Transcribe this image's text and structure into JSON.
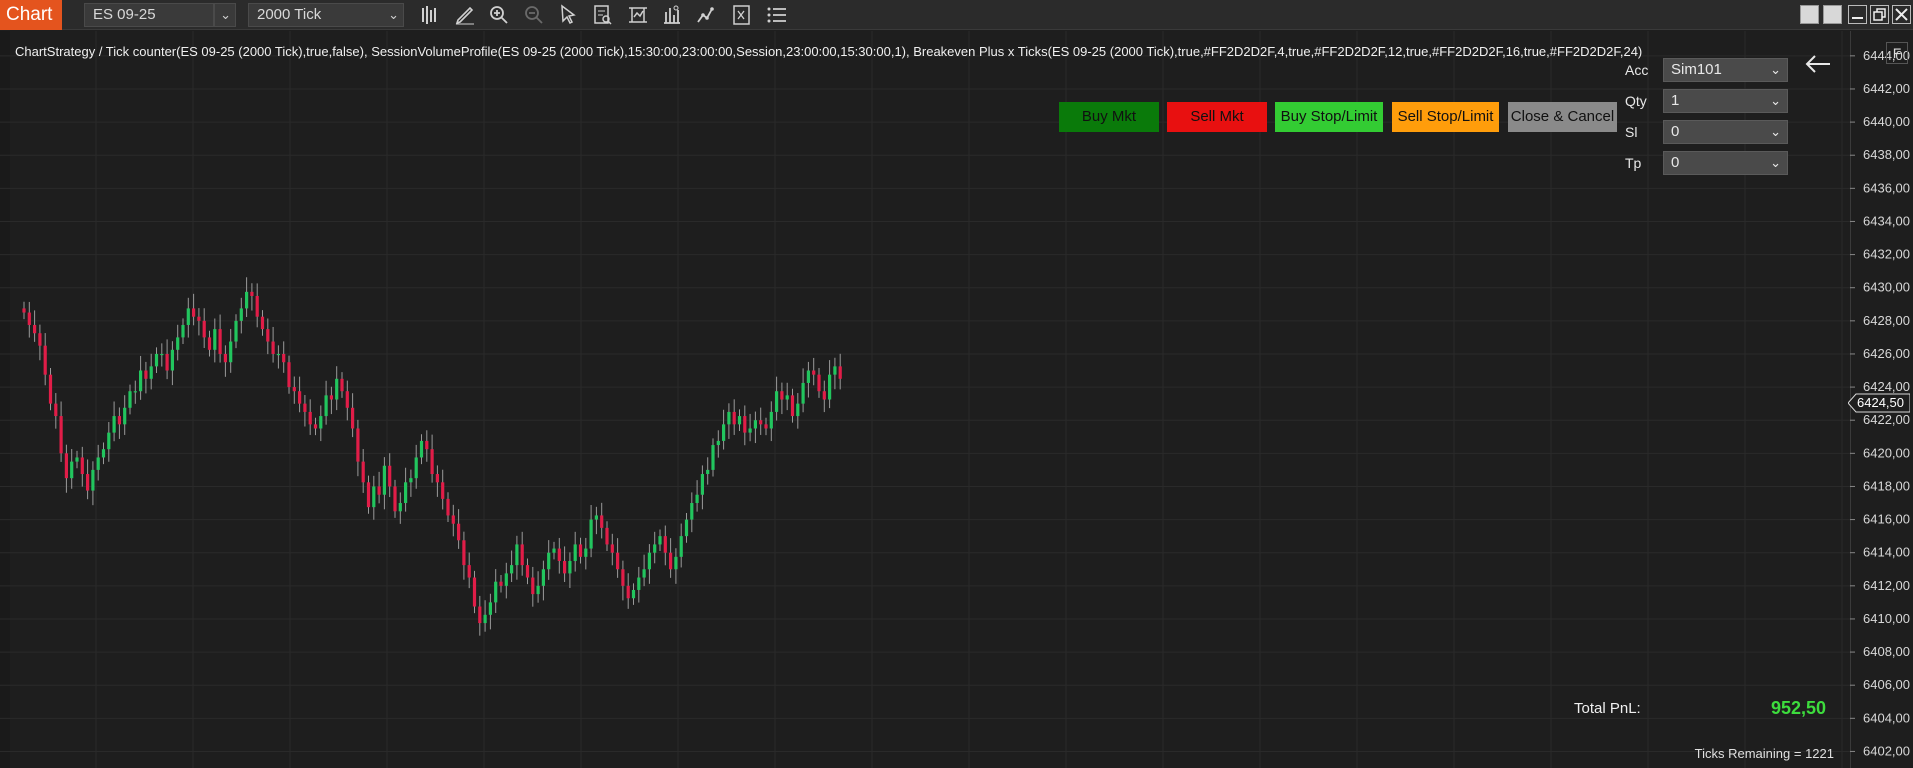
{
  "window": {
    "tab_label": "Chart",
    "instrument": "ES 09-25",
    "period": "2000 Tick",
    "tools": [
      "chart-style-icon",
      "drawing-pencil-icon",
      "zoom-in-icon",
      "zoom-out-icon",
      "pointer-icon",
      "data-box-icon",
      "indicators-icon",
      "strategies-icon",
      "chart-trader-icon",
      "properties-icon",
      "more-menu-icon"
    ]
  },
  "indicator_label": "ChartStrategy / Tick counter(ES 09-25 (2000 Tick),true,false), SessionVolumeProfile(ES 09-25 (2000 Tick),15:30:00,23:00:00,Session,23:00:00,15:30:00,1), Breakeven Plus x Ticks(ES 09-25 (2000 Tick),true,#FF2D2D2F,4,true,#FF2D2D2F,12,true,#FF2D2D2F,16,true,#FF2D2D2F,24)",
  "trade_buttons": {
    "buy_mkt": "Buy Mkt",
    "sell_mkt": "Sell Mkt",
    "buy_stop_limit": "Buy Stop/Limit",
    "sell_stop_limit": "Sell Stop/Limit",
    "close_cancel": "Close & Cancel"
  },
  "order_form": {
    "acc_label": "Acc",
    "acc_value": "Sim101",
    "qty_label": "Qty",
    "qty_value": "1",
    "sl_label": "Sl",
    "sl_value": "0",
    "tp_label": "Tp",
    "tp_value": "0"
  },
  "axis_button": "F",
  "current_price": "6424,50",
  "price_ticks": [
    "6444,00",
    "6442,00",
    "6440,00",
    "6438,00",
    "6436,00",
    "6434,00",
    "6432,00",
    "6430,00",
    "6428,00",
    "6426,00",
    "6424,00",
    "6422,00",
    "6420,00",
    "6418,00",
    "6416,00",
    "6414,00",
    "6412,00",
    "6410,00",
    "6408,00",
    "6406,00",
    "6404,00",
    "6402,00"
  ],
  "footer": {
    "pnl_label": "Total PnL:",
    "pnl_value": "952,50",
    "ticks_remaining": "Ticks Remaining = 1221"
  },
  "colors": {
    "chart_tab": "#e4541e",
    "up_candle": "#22c55e",
    "down_candle": "#e11d48",
    "pnl_positive": "#3ddc3d"
  },
  "chart_data": {
    "type": "candlestick",
    "ylim": [
      6401,
      6445.5
    ],
    "closes": [
      6428.5,
      6427.75,
      6427.25,
      6426.5,
      6424.75,
      6423.0,
      6422.25,
      6420.0,
      6418.5,
      6419.5,
      6419.75,
      6418.75,
      6417.75,
      6419.0,
      6419.75,
      6420.25,
      6421.25,
      6422.25,
      6421.75,
      6422.75,
      6423.75,
      6423.75,
      6425.0,
      6424.5,
      6425.25,
      6426.0,
      6426.0,
      6425.0,
      6426.25,
      6427.0,
      6427.75,
      6428.75,
      6428.25,
      6428.0,
      6427.0,
      6426.25,
      6427.5,
      6426.0,
      6425.5,
      6426.75,
      6428.0,
      6428.75,
      6429.75,
      6429.5,
      6428.25,
      6427.5,
      6426.75,
      6426.0,
      6426.0,
      6425.5,
      6424.0,
      6423.75,
      6423.0,
      6422.5,
      6421.75,
      6421.5,
      6422.25,
      6423.5,
      6423.25,
      6424.5,
      6423.75,
      6422.75,
      6421.5,
      6419.5,
      6418.25,
      6416.75,
      6418.0,
      6417.5,
      6419.25,
      6418.0,
      6416.5,
      6417.0,
      6418.25,
      6418.5,
      6419.75,
      6420.75,
      6420.25,
      6418.75,
      6418.25,
      6417.25,
      6416.25,
      6415.75,
      6414.75,
      6413.25,
      6412.5,
      6410.75,
      6409.75,
      6410.25,
      6411.0,
      6412.25,
      6412.0,
      6412.75,
      6413.25,
      6414.5,
      6413.25,
      6412.5,
      6411.5,
      6412.0,
      6413.0,
      6414.0,
      6414.25,
      6413.5,
      6412.75,
      6413.5,
      6414.5,
      6413.75,
      6414.25,
      6416.0,
      6416.25,
      6415.5,
      6414.5,
      6414.0,
      6413.0,
      6412.0,
      6411.25,
      6411.75,
      6412.5,
      6413.0,
      6414.0,
      6414.5,
      6415.0,
      6414.0,
      6413.0,
      6413.75,
      6415.0,
      6416.0,
      6417.0,
      6417.5,
      6418.75,
      6419.0,
      6420.5,
      6420.75,
      6421.75,
      6422.5,
      6421.75,
      6422.25,
      6421.25,
      6421.5,
      6422.0,
      6421.75,
      6421.5,
      6422.5,
      6423.75,
      6423.25,
      6423.5,
      6422.25,
      6423.0,
      6424.25,
      6425.0,
      6424.75,
      6423.75,
      6423.25,
      6424.75,
      6425.25,
      6424.5
    ]
  }
}
